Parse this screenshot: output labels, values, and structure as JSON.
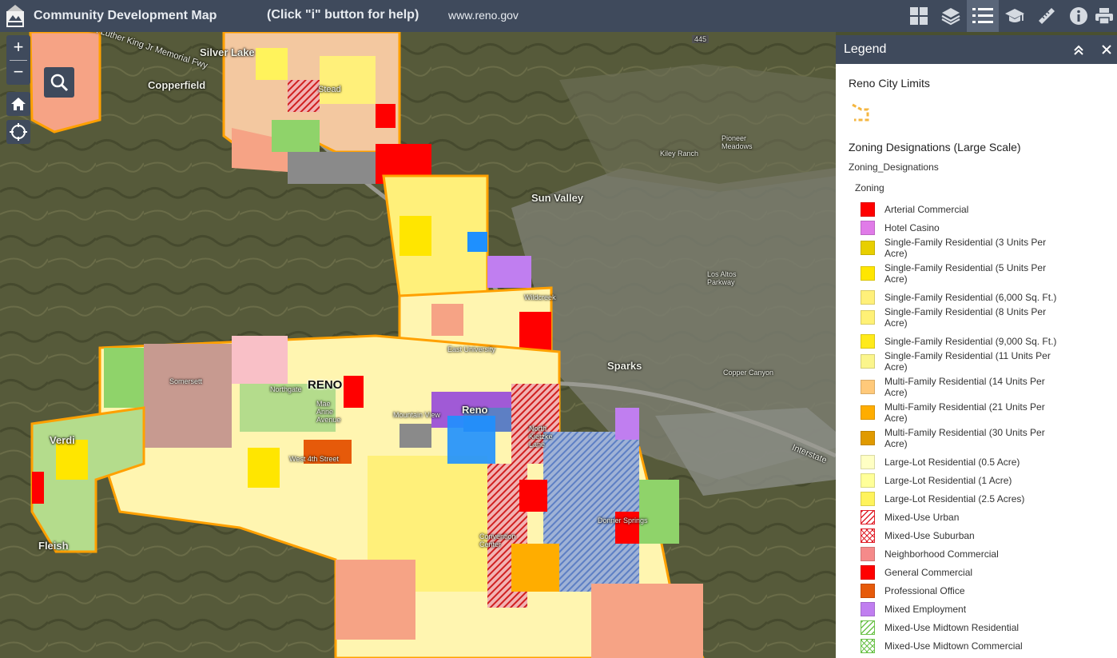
{
  "header": {
    "title": "Community Development Map",
    "help_text": "(Click \"i\" button for help)",
    "site": "www.reno.gov",
    "logo_icon": "reno-city-logo",
    "buttons": [
      {
        "name": "basemap-gallery-button",
        "icon": "grid-icon"
      },
      {
        "name": "layer-list-button",
        "icon": "layers-icon"
      },
      {
        "name": "legend-button",
        "icon": "list-icon",
        "active": true
      },
      {
        "name": "education-button",
        "icon": "graduation-cap-icon"
      },
      {
        "name": "measure-button",
        "icon": "ruler-icon"
      },
      {
        "name": "about-button",
        "icon": "info-icon"
      },
      {
        "name": "print-button",
        "icon": "printer-icon"
      }
    ]
  },
  "map": {
    "zoom_in": "+",
    "zoom_out": "−",
    "labels": [
      {
        "id": "mlk",
        "text": "Martin Luther King Jr Memorial Fwy"
      },
      {
        "id": "silverlake",
        "text": "Silver Lake"
      },
      {
        "id": "copperfield",
        "text": "Copperfield"
      },
      {
        "id": "stead",
        "text": "Stead"
      },
      {
        "id": "sunvalley",
        "text": "Sun Valley"
      },
      {
        "id": "pioneer",
        "text": "Pioneer Meadows"
      },
      {
        "id": "kiley",
        "text": "Kiley Ranch"
      },
      {
        "id": "losaltos",
        "text": "Los Altos Parkway"
      },
      {
        "id": "wildcreek",
        "text": "Wildcreek"
      },
      {
        "id": "eastuniv",
        "text": "East University"
      },
      {
        "id": "sparks",
        "text": "Sparks"
      },
      {
        "id": "somersett",
        "text": "Somersett"
      },
      {
        "id": "northgate",
        "text": "Northgate"
      },
      {
        "id": "reno_city",
        "text": "RENO"
      },
      {
        "id": "mayanne",
        "text": "Mae Anne Avenue"
      },
      {
        "id": "mountainview",
        "text": "Mountain View"
      },
      {
        "id": "reno",
        "text": "Reno"
      },
      {
        "id": "coppercanyon",
        "text": "Copper Canyon"
      },
      {
        "id": "verdi",
        "text": "Verdi"
      },
      {
        "id": "west4th",
        "text": "West 4th Street"
      },
      {
        "id": "northkietzke",
        "text": "North Kietzke Lane"
      },
      {
        "id": "convention",
        "text": "Convention Center"
      },
      {
        "id": "donnersprings",
        "text": "Donner Springs"
      },
      {
        "id": "fleish",
        "text": "Fleish"
      },
      {
        "id": "interstate",
        "text": "Interstate"
      },
      {
        "id": "hwy445",
        "text": "445"
      }
    ]
  },
  "legend": {
    "title": "Legend",
    "layer1": "Reno City Limits",
    "layer2": "Zoning Designations (Large Scale)",
    "sublayer": "Zoning_Designations",
    "field": "Zoning",
    "items": [
      {
        "label": "Arterial Commercial",
        "color": "#ff0000",
        "pattern": "solid"
      },
      {
        "label": "Hotel Casino",
        "color": "#e07be8",
        "pattern": "solid"
      },
      {
        "label": "Single-Family Residential (3 Units Per Acre)",
        "color": "#e8cf00",
        "pattern": "solid"
      },
      {
        "label": "Single-Family Residential (5 Units Per Acre)",
        "color": "#ffe600",
        "pattern": "solid"
      },
      {
        "label": "Single-Family Residential (6,000 Sq. Ft.)",
        "color": "#fff07a",
        "pattern": "solid"
      },
      {
        "label": "Single-Family Residential (8 Units Per Acre)",
        "color": "#fff176",
        "pattern": "solid"
      },
      {
        "label": "Single-Family Residential (9,000 Sq. Ft.)",
        "color": "#ffea1a",
        "pattern": "solid"
      },
      {
        "label": "Single-Family Residential (11 Units Per Acre)",
        "color": "#fbf58c",
        "pattern": "solid"
      },
      {
        "label": "Multi-Family Residential (14 Units Per Acre)",
        "color": "#ffc97a",
        "pattern": "solid"
      },
      {
        "label": "Multi-Family Residential (21 Units Per Acre)",
        "color": "#ffad00",
        "pattern": "solid"
      },
      {
        "label": "Multi-Family Residential (30 Units Per Acre)",
        "color": "#e09a00",
        "pattern": "solid"
      },
      {
        "label": "Large-Lot Residential (0.5 Acre)",
        "color": "#ffffc4",
        "pattern": "solid"
      },
      {
        "label": "Large-Lot Residential (1 Acre)",
        "color": "#ffff99",
        "pattern": "solid"
      },
      {
        "label": "Large-Lot Residential (2.5 Acres)",
        "color": "#fff35c",
        "pattern": "solid"
      },
      {
        "label": "Mixed-Use Urban",
        "color": "#e0202a",
        "pattern": "hatch"
      },
      {
        "label": "Mixed-Use Suburban",
        "color": "#e0202a",
        "pattern": "crosshatch"
      },
      {
        "label": "Neighborhood Commercial",
        "color": "#f58a8a",
        "pattern": "solid"
      },
      {
        "label": "General Commercial",
        "color": "#ff0000",
        "pattern": "solid"
      },
      {
        "label": "Professional Office",
        "color": "#e65a0a",
        "pattern": "solid"
      },
      {
        "label": "Mixed Employment",
        "color": "#c07ef0",
        "pattern": "solid"
      },
      {
        "label": "Mixed-Use Midtown Residential",
        "color": "#6cc24a",
        "pattern": "hatch"
      },
      {
        "label": "Mixed-Use Midtown Commercial",
        "color": "#6cc24a",
        "pattern": "crosshatch"
      }
    ]
  }
}
